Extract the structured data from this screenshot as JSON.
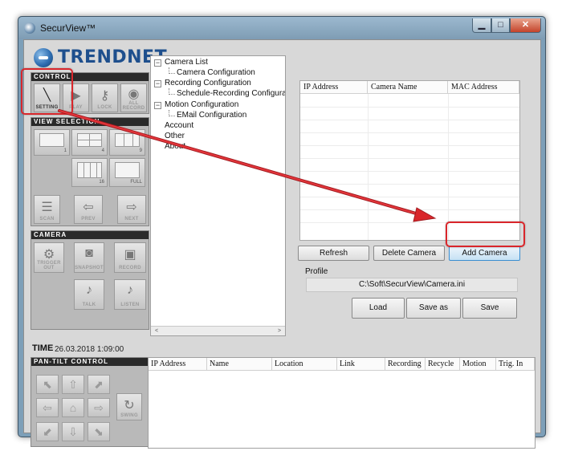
{
  "window": {
    "title": "SecurView™",
    "controls": {
      "minimize": "▁",
      "maximize": "□",
      "close": "✕"
    }
  },
  "brand": {
    "logo_text": "TRENDNET"
  },
  "control": {
    "header": "CONTROL",
    "buttons": [
      {
        "label": "SETTING",
        "icon": "wrench-icon"
      },
      {
        "label": "PLAY",
        "icon": "play-icon"
      },
      {
        "label": "LOCK",
        "icon": "key-icon"
      },
      {
        "label": "ALL RECORD",
        "icon": "all-record-icon"
      }
    ]
  },
  "view_selection": {
    "header": "VIEW SELECTION",
    "buttons": [
      {
        "label": "1"
      },
      {
        "label": "4"
      },
      {
        "label": "9"
      },
      {
        "label": "16"
      },
      {
        "label": "FULL"
      },
      {
        "label": "SCAN"
      },
      {
        "label": "PREV"
      },
      {
        "label": "NEXT"
      }
    ]
  },
  "camera": {
    "header": "CAMERA",
    "buttons": [
      {
        "label": "TRIGGER OUT",
        "icon": "trigger-icon"
      },
      {
        "label": "SNAPSHOT",
        "icon": "snapshot-icon"
      },
      {
        "label": "RECORD",
        "icon": "record-icon"
      },
      {
        "label": "TALK",
        "icon": "talk-icon"
      },
      {
        "label": "LISTEN",
        "icon": "listen-icon"
      }
    ]
  },
  "time": {
    "label": "TIME",
    "value": "26.03.2018 1:09:00"
  },
  "pan_tilt": {
    "header": "PAN-TILT CONTROL",
    "swing_label": "SWING"
  },
  "tree": {
    "expander_symbol": "−",
    "items": [
      {
        "label": "Camera List"
      },
      {
        "label": "Camera Configuration"
      },
      {
        "label": "Recording Configuration"
      },
      {
        "label": "Schedule-Recording Configuration"
      },
      {
        "label": "Motion Configuration"
      },
      {
        "label": "EMail Configuration"
      },
      {
        "label": "Account"
      },
      {
        "label": "Other"
      },
      {
        "label": "About"
      }
    ],
    "scroll_left": "<",
    "scroll_right": ">"
  },
  "camera_list": {
    "columns": [
      "IP Address",
      "Camera Name",
      "MAC Address"
    ]
  },
  "actions": {
    "refresh": "Refresh",
    "delete": "Delete Camera",
    "add": "Add Camera"
  },
  "profile": {
    "label": "Profile",
    "path": "C:\\Soft\\SecurView\\Camera.ini",
    "load": "Load",
    "save_as": "Save as",
    "save": "Save"
  },
  "status_table": {
    "columns": [
      "IP Address",
      "Name",
      "Location",
      "Link",
      "Recording",
      "Recycle",
      "Motion",
      "Trig. In"
    ]
  },
  "colors": {
    "highlight": "#d9262b",
    "accent": "#3b8ed1",
    "logo": "#1e4f8d"
  }
}
